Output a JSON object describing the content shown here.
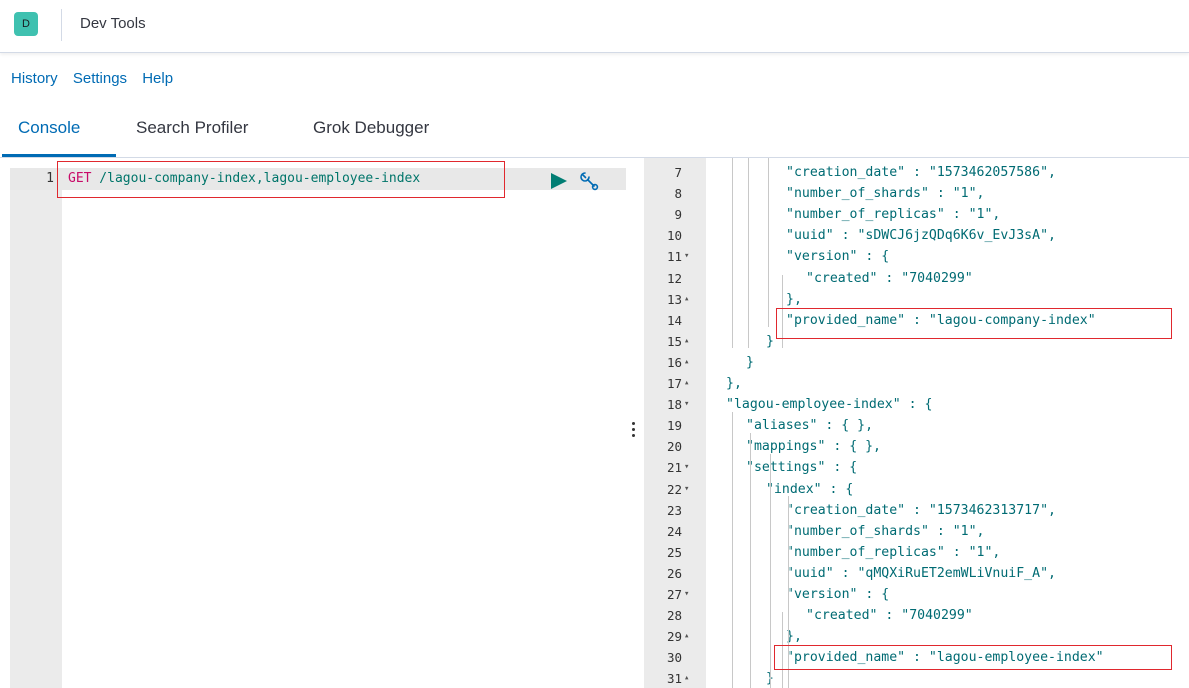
{
  "header": {
    "avatar_letter": "D",
    "title": "Dev Tools",
    "accent_color": "#3fc1b0"
  },
  "menu": {
    "items": [
      "History",
      "Settings",
      "Help"
    ]
  },
  "tabs": [
    {
      "label": "Console",
      "active": true
    },
    {
      "label": "Search Profiler",
      "active": false
    },
    {
      "label": "Grok Debugger",
      "active": false
    }
  ],
  "editor": {
    "line_number": "1",
    "method": "GET",
    "path": " /lagou-company-index,lagou-employee-index",
    "play_icon": "play-icon",
    "settings_icon": "wrench-icon"
  },
  "output": {
    "lines": [
      {
        "num": "7",
        "fold": "",
        "text": "\"creation_date\" : \"1573462057586\","
      },
      {
        "num": "8",
        "fold": "",
        "text": "\"number_of_shards\" : \"1\","
      },
      {
        "num": "9",
        "fold": "",
        "text": "\"number_of_replicas\" : \"1\","
      },
      {
        "num": "10",
        "fold": "",
        "text": "\"uuid\" : \"sDWCJ6jzQDq6K6v_EvJ3sA\","
      },
      {
        "num": "11",
        "fold": "▾",
        "text": "\"version\" : {"
      },
      {
        "num": "12",
        "fold": "",
        "text": "\"created\" : \"7040299\""
      },
      {
        "num": "13",
        "fold": "▴",
        "text": "},"
      },
      {
        "num": "14",
        "fold": "",
        "text": "\"provided_name\" : \"lagou-company-index\""
      },
      {
        "num": "15",
        "fold": "▴",
        "text": "}"
      },
      {
        "num": "16",
        "fold": "▴",
        "text": "}"
      },
      {
        "num": "17",
        "fold": "▴",
        "text": "},"
      },
      {
        "num": "18",
        "fold": "▾",
        "text": "\"lagou-employee-index\" : {"
      },
      {
        "num": "19",
        "fold": "",
        "text": "\"aliases\" : { },"
      },
      {
        "num": "20",
        "fold": "",
        "text": "\"mappings\" : { },"
      },
      {
        "num": "21",
        "fold": "▾",
        "text": "\"settings\" : {"
      },
      {
        "num": "22",
        "fold": "▾",
        "text": "\"index\" : {"
      },
      {
        "num": "23",
        "fold": "",
        "text": "\"creation_date\" : \"1573462313717\","
      },
      {
        "num": "24",
        "fold": "",
        "text": "\"number_of_shards\" : \"1\","
      },
      {
        "num": "25",
        "fold": "",
        "text": "\"number_of_replicas\" : \"1\","
      },
      {
        "num": "26",
        "fold": "",
        "text": "\"uuid\" : \"qMQXiRuET2emWLiVnuiF_A\","
      },
      {
        "num": "27",
        "fold": "▾",
        "text": "\"version\" : {"
      },
      {
        "num": "28",
        "fold": "",
        "text": "\"created\" : \"7040299\""
      },
      {
        "num": "29",
        "fold": "▴",
        "text": "},"
      },
      {
        "num": "30",
        "fold": "",
        "text": "\"provided_name\" : \"lagou-employee-index\""
      },
      {
        "num": "31",
        "fold": "▴",
        "text": "}"
      }
    ]
  }
}
